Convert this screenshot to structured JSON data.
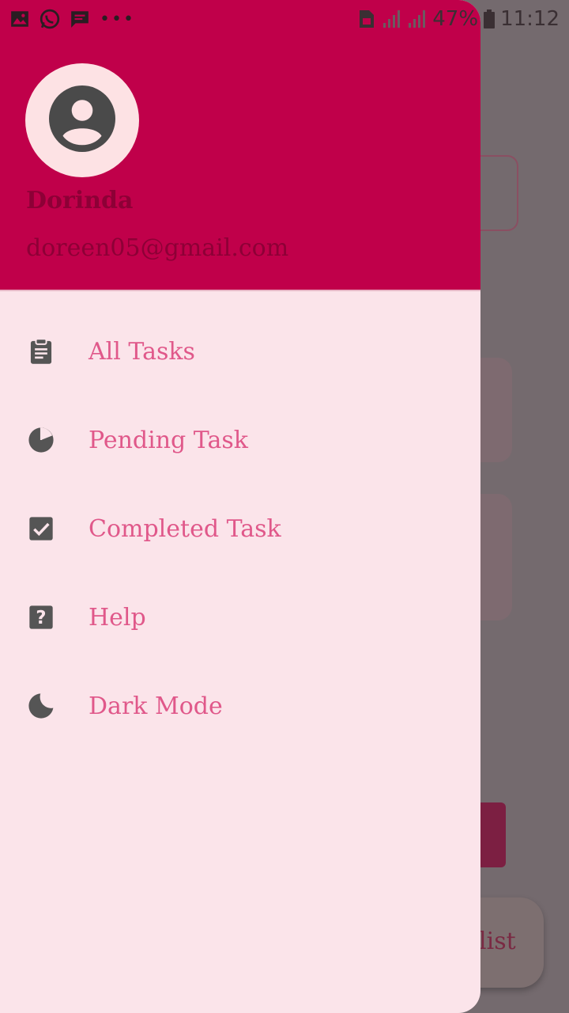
{
  "status_bar": {
    "battery_percent": "47%",
    "time": "11:12",
    "overflow": "•••",
    "icons": [
      "gallery-icon",
      "whatsapp-icon",
      "message-icon",
      "sim-icon",
      "signal-icon",
      "signal-icon",
      "battery-icon"
    ]
  },
  "drawer": {
    "header": {
      "avatar_icon": "account-circle-icon",
      "user_name": "Dorinda",
      "user_email": "doreen05@gmail.com"
    },
    "menu": [
      {
        "label": "All Tasks",
        "icon": "clipboard-icon"
      },
      {
        "label": "Pending Task",
        "icon": "pie-chart-icon"
      },
      {
        "label": "Completed Task",
        "icon": "check-box-icon"
      },
      {
        "label": "Help",
        "icon": "help-icon"
      },
      {
        "label": "Dark Mode",
        "icon": "moon-icon"
      }
    ]
  },
  "background": {
    "fab_label_fragment": "list"
  },
  "colors": {
    "header": "#c0004a",
    "drawer_bg": "#fbe4ea",
    "menu_text": "#e0588a",
    "icon": "#555555",
    "scrim": "#746a6e"
  }
}
